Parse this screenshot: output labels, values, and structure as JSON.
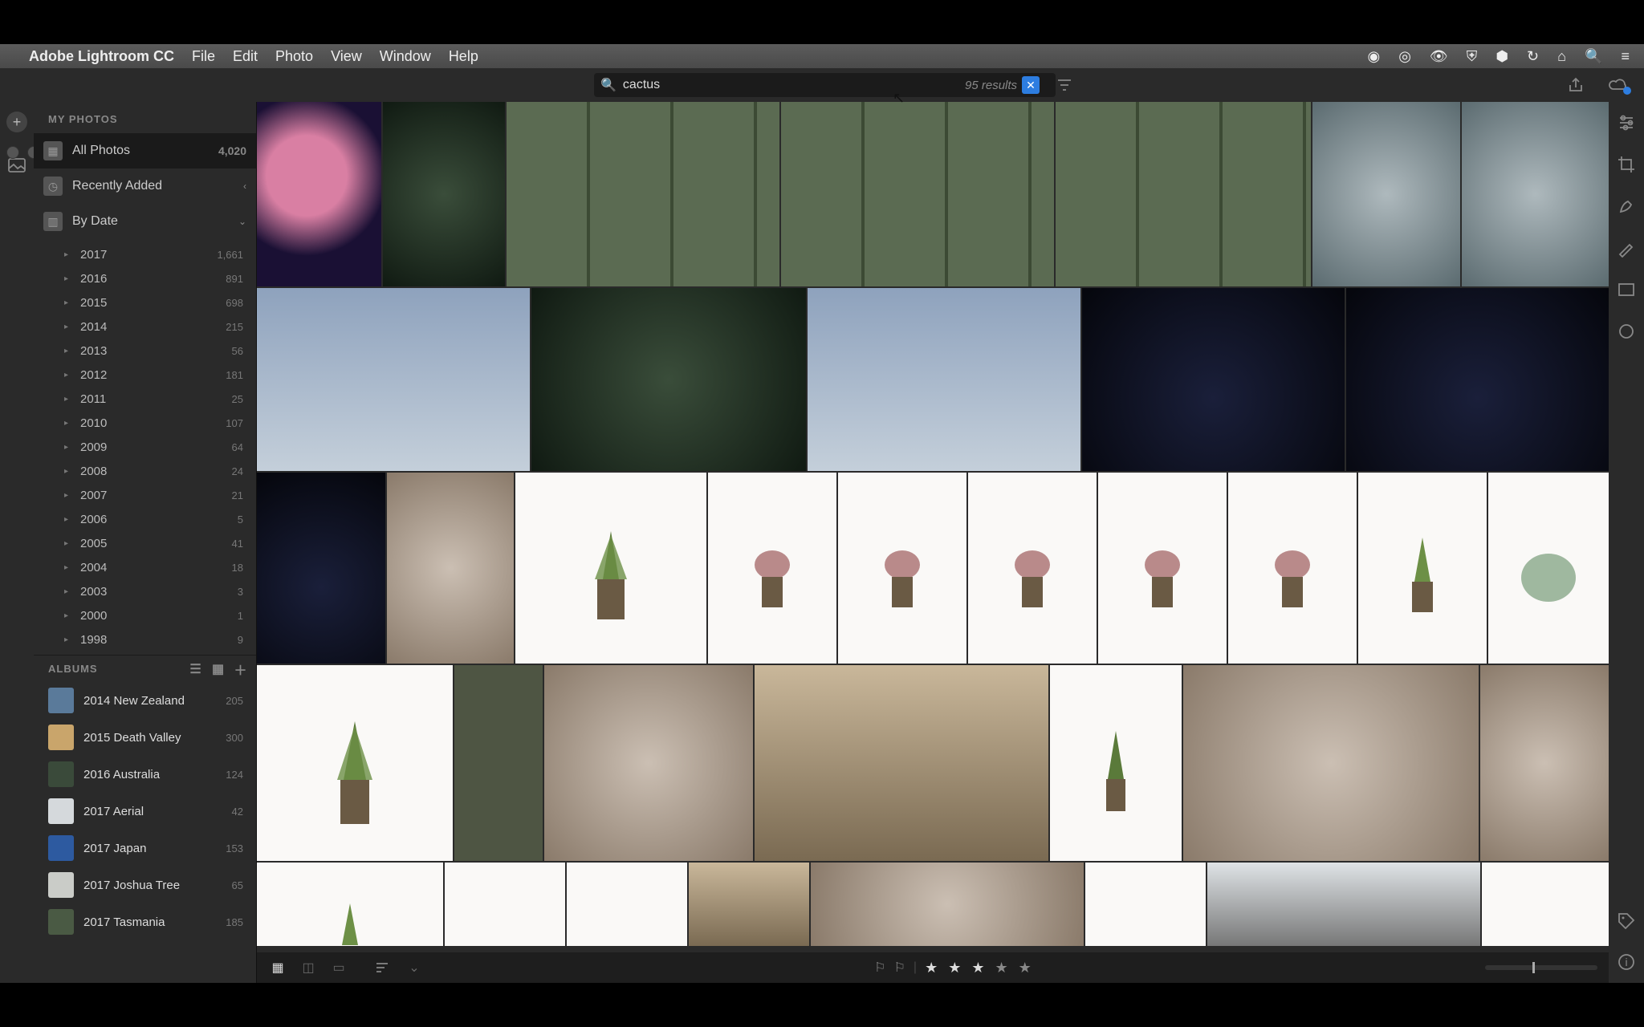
{
  "menubar": {
    "app_name": "Adobe Lightroom CC",
    "menus": [
      "File",
      "Edit",
      "Photo",
      "View",
      "Window",
      "Help"
    ]
  },
  "search": {
    "value": "cactus",
    "results_label": "95 results"
  },
  "sidebar": {
    "header": "MY PHOTOS",
    "all_photos": {
      "label": "All Photos",
      "count": "4,020"
    },
    "recently_added": {
      "label": "Recently Added"
    },
    "by_date": {
      "label": "By Date"
    },
    "years": [
      {
        "label": "2017",
        "count": "1,661"
      },
      {
        "label": "2016",
        "count": "891"
      },
      {
        "label": "2015",
        "count": "698"
      },
      {
        "label": "2014",
        "count": "215"
      },
      {
        "label": "2013",
        "count": "56"
      },
      {
        "label": "2012",
        "count": "181"
      },
      {
        "label": "2011",
        "count": "25"
      },
      {
        "label": "2010",
        "count": "107"
      },
      {
        "label": "2009",
        "count": "64"
      },
      {
        "label": "2008",
        "count": "24"
      },
      {
        "label": "2007",
        "count": "21"
      },
      {
        "label": "2006",
        "count": "5"
      },
      {
        "label": "2005",
        "count": "41"
      },
      {
        "label": "2004",
        "count": "18"
      },
      {
        "label": "2003",
        "count": "3"
      },
      {
        "label": "2000",
        "count": "1"
      },
      {
        "label": "1998",
        "count": "9"
      }
    ]
  },
  "albums": {
    "header": "ALBUMS",
    "items": [
      {
        "label": "2014 New Zealand",
        "count": "205"
      },
      {
        "label": "2015 Death Valley",
        "count": "300"
      },
      {
        "label": "2016 Australia",
        "count": "124"
      },
      {
        "label": "2017 Aerial",
        "count": "42"
      },
      {
        "label": "2017 Japan",
        "count": "153"
      },
      {
        "label": "2017 Joshua Tree",
        "count": "65"
      },
      {
        "label": "2017 Tasmania",
        "count": "185"
      }
    ]
  },
  "gridbar": {
    "zoom_pos_pct": 42
  }
}
